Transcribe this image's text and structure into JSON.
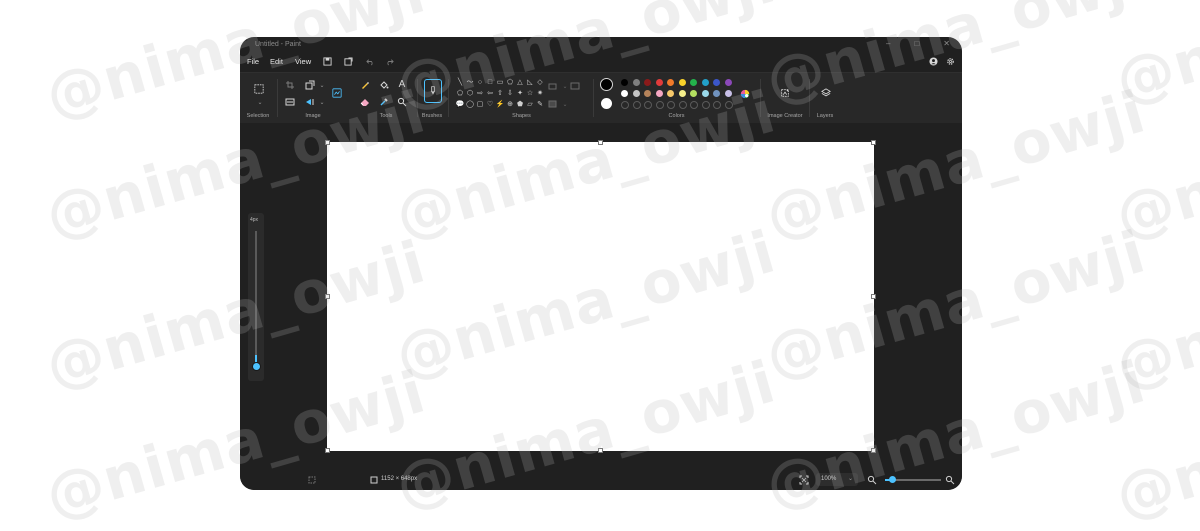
{
  "window": {
    "title": "Untitled - Paint",
    "controls": [
      "–",
      "□",
      "✕"
    ]
  },
  "menu": {
    "file": "File",
    "edit": "Edit",
    "view": "View"
  },
  "ribbon": {
    "groups": {
      "selection": "Selection",
      "image": "Image",
      "tools": "Tools",
      "brushes": "Brushes",
      "shapes": "Shapes",
      "colors": "Colors",
      "image_creator": "Image Creator",
      "layers": "Layers"
    },
    "text_tool_glyph": "A",
    "shape_glyphs": [
      "╲",
      "〜",
      "○",
      "□",
      "▭",
      "⬠",
      "△",
      "◺",
      "◇",
      "⬠",
      "⬡",
      "⇨",
      "⇦",
      "⇧",
      "⇩",
      "✦",
      "☆",
      "✷",
      "💬",
      "◯",
      "▢",
      "♡",
      "⚡",
      "⊕",
      "⬟",
      "▱",
      "✎"
    ],
    "colors_row1": [
      "#000000",
      "#7f7f7f",
      "#8b1a1a",
      "#e23b3b",
      "#f07a2a",
      "#f8d22a",
      "#24b24c",
      "#22a0c8",
      "#3b56c9",
      "#8b48b8"
    ],
    "colors_row2": [
      "#ffffff",
      "#c3c3c3",
      "#b5835a",
      "#f5a7c2",
      "#f7c96b",
      "#f4ee8b",
      "#b5e061",
      "#9ad9ea",
      "#7092be",
      "#c8bfe7"
    ]
  },
  "primary_color": "#000000",
  "secondary_color": "#ffffff",
  "accent": "#4cc2ff",
  "side_slider": {
    "label": "4px"
  },
  "status": {
    "canvas_size": "1152 × 648px",
    "zoom": "100%"
  },
  "watermark": "@nima_owji"
}
